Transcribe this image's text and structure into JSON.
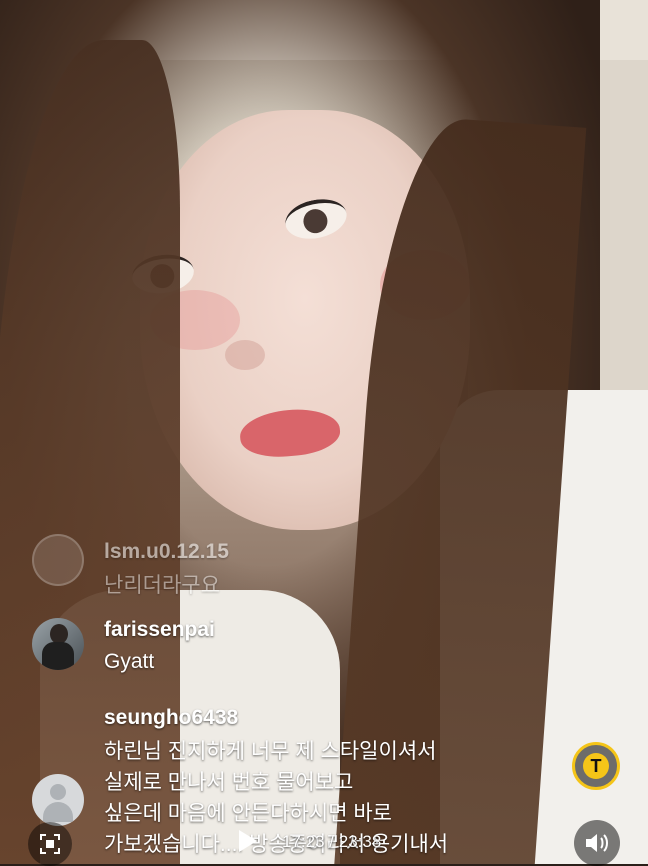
{
  "comments": [
    {
      "author": "lsm.u0.12.15",
      "text": "난리더라구요"
    },
    {
      "author": "farissenpai",
      "text": "Gyatt"
    },
    {
      "author": "seungho6438",
      "text": "하린님 진지하게 너무 제 스타일이셔서\n실제로 만나서 번호 물어보고\n싶은데 마음에 안든다하시면 바로\n가보겠습니다.... 방송중이라서 용기내서"
    }
  ],
  "player": {
    "current_time": "17:23",
    "separator": "/",
    "duration": "23:38"
  },
  "icons": {
    "translate": "translate-icon",
    "expand": "expand-icon",
    "play": "play-icon",
    "sound": "sound-icon"
  },
  "colors": {
    "translate_accent": "#f5c518"
  }
}
